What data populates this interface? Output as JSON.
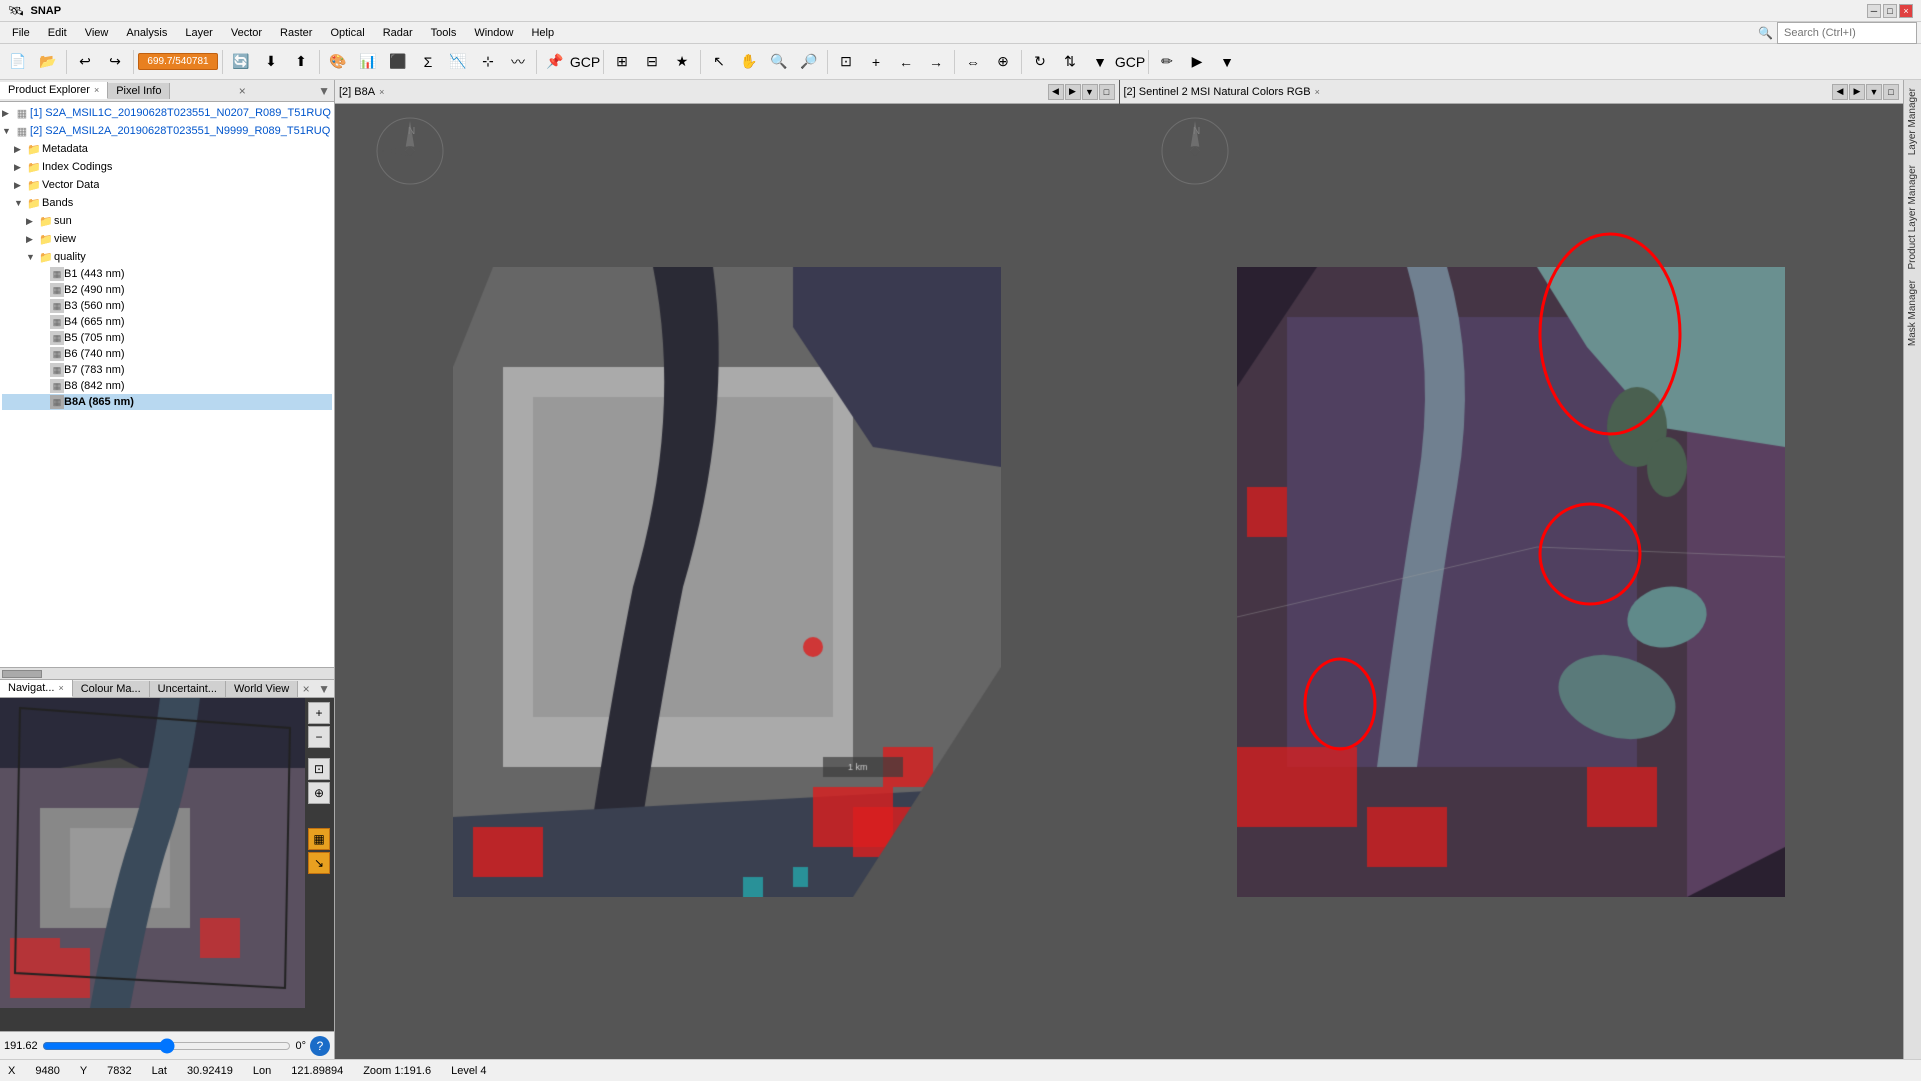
{
  "app": {
    "title": "SNAP",
    "window_controls": [
      "minimize",
      "maximize",
      "close"
    ]
  },
  "menu": {
    "items": [
      "File",
      "Edit",
      "View",
      "Analysis",
      "Layer",
      "Vector",
      "Raster",
      "Optical",
      "Radar",
      "Tools",
      "Window",
      "Help"
    ]
  },
  "toolbar": {
    "zoom_value": "699.7/540781",
    "search_placeholder": "Search (Ctrl+I)"
  },
  "product_explorer": {
    "tab_label": "Product Explorer",
    "pixel_info_label": "Pixel Info",
    "items": [
      {
        "id": "s2a_1",
        "label": "S2A_MSIL1C_20190628T023551_N0207_R089_T51RUQ",
        "expanded": true,
        "level": 0,
        "type": "product"
      },
      {
        "id": "s2a_2",
        "label": "S2A_MSIL2A_20190628T023551_N9999_R089_T51RUQ",
        "expanded": true,
        "level": 0,
        "type": "product"
      },
      {
        "id": "metadata",
        "label": "Metadata",
        "level": 1,
        "type": "folder"
      },
      {
        "id": "index_codings",
        "label": "Index Codings",
        "level": 1,
        "type": "folder"
      },
      {
        "id": "vector_data",
        "label": "Vector Data",
        "level": 1,
        "type": "folder"
      },
      {
        "id": "bands",
        "label": "Bands",
        "level": 1,
        "expanded": true,
        "type": "folder"
      },
      {
        "id": "sun",
        "label": "sun",
        "level": 2,
        "type": "folder"
      },
      {
        "id": "view",
        "label": "view",
        "level": 2,
        "type": "folder"
      },
      {
        "id": "quality",
        "label": "quality",
        "level": 2,
        "expanded": true,
        "type": "folder"
      },
      {
        "id": "b1",
        "label": "B1 (443 nm)",
        "level": 3,
        "type": "band"
      },
      {
        "id": "b2",
        "label": "B2 (490 nm)",
        "level": 3,
        "type": "band"
      },
      {
        "id": "b3",
        "label": "B3 (560 nm)",
        "level": 3,
        "type": "band"
      },
      {
        "id": "b4",
        "label": "B4 (665 nm)",
        "level": 3,
        "type": "band"
      },
      {
        "id": "b5",
        "label": "B5 (705 nm)",
        "level": 3,
        "type": "band"
      },
      {
        "id": "b6",
        "label": "B6 (740 nm)",
        "level": 3,
        "type": "band"
      },
      {
        "id": "b7",
        "label": "B7 (783 nm)",
        "level": 3,
        "type": "band"
      },
      {
        "id": "b8",
        "label": "B8 (842 nm)",
        "level": 3,
        "type": "band"
      },
      {
        "id": "b8a",
        "label": "B8A (865 nm)",
        "level": 3,
        "type": "band",
        "active": true
      }
    ]
  },
  "bottom_panels": {
    "navigator_label": "Navigat...",
    "colour_map_label": "Colour Ma...",
    "uncertainty_label": "Uncertaint...",
    "world_view_label": "World View"
  },
  "center_panel": {
    "tab_label": "[2] B8A",
    "close_icon": "×"
  },
  "right_panel": {
    "tab_label": "[2] Sentinel 2 MSI Natural Colors RGB",
    "close_icon": "×",
    "labels": [
      "Layer Manager",
      "Product Layer Manager",
      "Mask Manager"
    ]
  },
  "status_bar": {
    "x_label": "X",
    "x_value": "9480",
    "y_label": "Y",
    "y_value": "7832",
    "lat_label": "Lat",
    "lat_value": "30.92419",
    "lon_label": "Lon",
    "lon_value": "121.89894",
    "zoom_label": "Zoom 1:191.6",
    "level_label": "Level 4"
  },
  "navigator": {
    "zoom_value": "191.62",
    "rotation": "0°"
  },
  "icons": {
    "close": "×",
    "minimize": "─",
    "maximize": "□",
    "expand": "▶",
    "collapse": "▼",
    "folder": "📁",
    "band": "▦",
    "zoom_in": "+",
    "zoom_out": "−",
    "arrow_left": "◀",
    "arrow_right": "▶",
    "arrow_up": "▲",
    "arrow_down": "▼",
    "help": "?"
  }
}
